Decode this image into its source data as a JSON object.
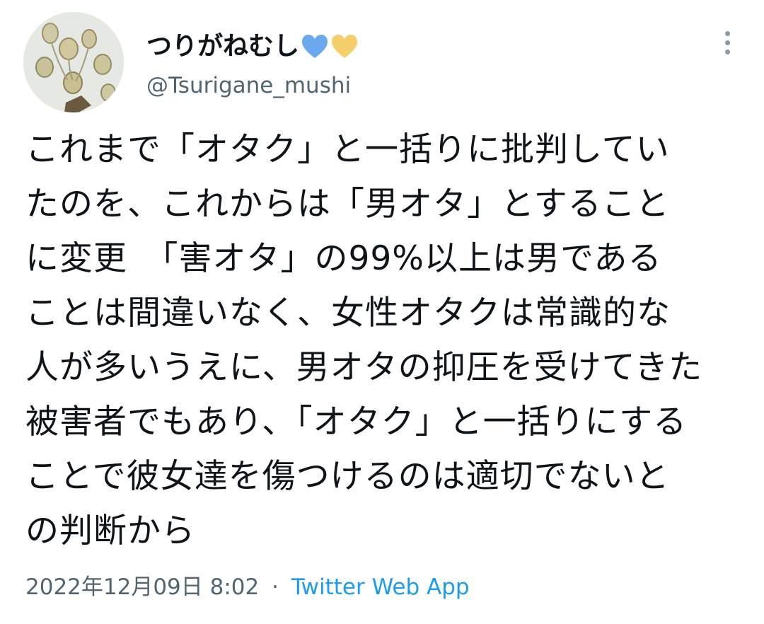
{
  "author": {
    "display_name": "つりがねむし",
    "handle": "@Tsurigane_mushi",
    "avatar_icon": "vorticella-microscope-avatar",
    "emoji": [
      {
        "name": "blue-heart-icon",
        "color": "#6aa9ee"
      },
      {
        "name": "yellow-heart-icon",
        "color": "#f4cf6a"
      }
    ]
  },
  "tweet": {
    "lines": [
      "これまで「オタク」と一括りに批判してい",
      "たのを、これからは「男オタ」とすること",
      "に変更　「害オタ」の99%以上は男である",
      "ことは間違いなく、女性オタクは常識的な",
      "人が多いうえに、男オタの抑圧を受けてきた",
      "被害者でもあり、「オタク」と一括りにする",
      "ことで彼女達を傷つけるのは適切でないと",
      "の判断から"
    ]
  },
  "meta": {
    "datetime": "2022年12月09日 8:02",
    "separator": "·",
    "source": "Twitter Web App"
  },
  "colors": {
    "text": "#0f1419",
    "secondary": "#536471",
    "link": "#1d9bf0"
  }
}
